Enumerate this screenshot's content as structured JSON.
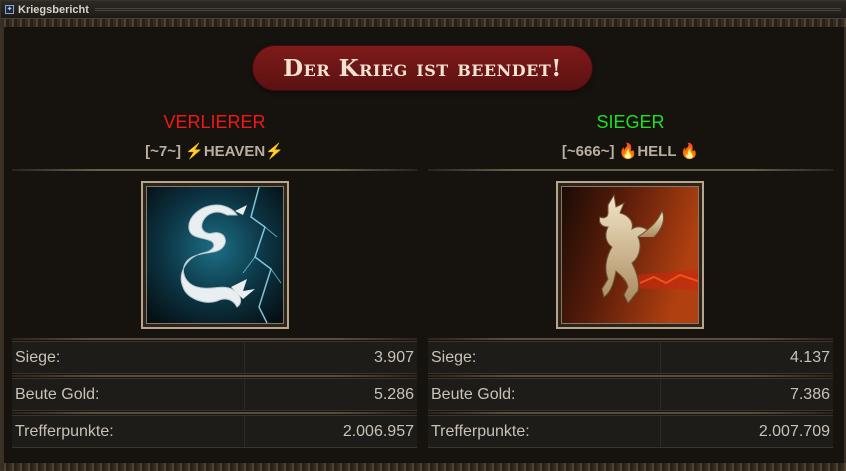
{
  "window": {
    "title": "Kriegsbericht"
  },
  "banner": {
    "text": "Der Krieg ist beendet!"
  },
  "loser": {
    "outcome": "VERLIERER",
    "guild_tag": "[~7~]",
    "guild_prefix_emoji": "⚡",
    "guild_name": "HEAVEN",
    "guild_suffix_emoji": "⚡",
    "emblem_icon": "ice-dragon-emblem-icon",
    "stats": [
      {
        "label": "Siege:",
        "value": "3.907"
      },
      {
        "label": "Beute Gold:",
        "value": "5.286"
      },
      {
        "label": "Trefferpunkte:",
        "value": "2.006.957"
      }
    ]
  },
  "winner": {
    "outcome": "SIEGER",
    "guild_tag": "[~666~]",
    "guild_prefix_emoji": "🔥",
    "guild_name": "HELL",
    "guild_suffix_emoji": "🔥",
    "emblem_icon": "fire-griffin-emblem-icon",
    "stats": [
      {
        "label": "Siege:",
        "value": "4.137"
      },
      {
        "label": "Beute Gold:",
        "value": "7.386"
      },
      {
        "label": "Trefferpunkte:",
        "value": "2.007.709"
      }
    ]
  },
  "colors": {
    "loser": "#f01818",
    "winner": "#1ee01e",
    "banner": "#7f1a1a"
  }
}
